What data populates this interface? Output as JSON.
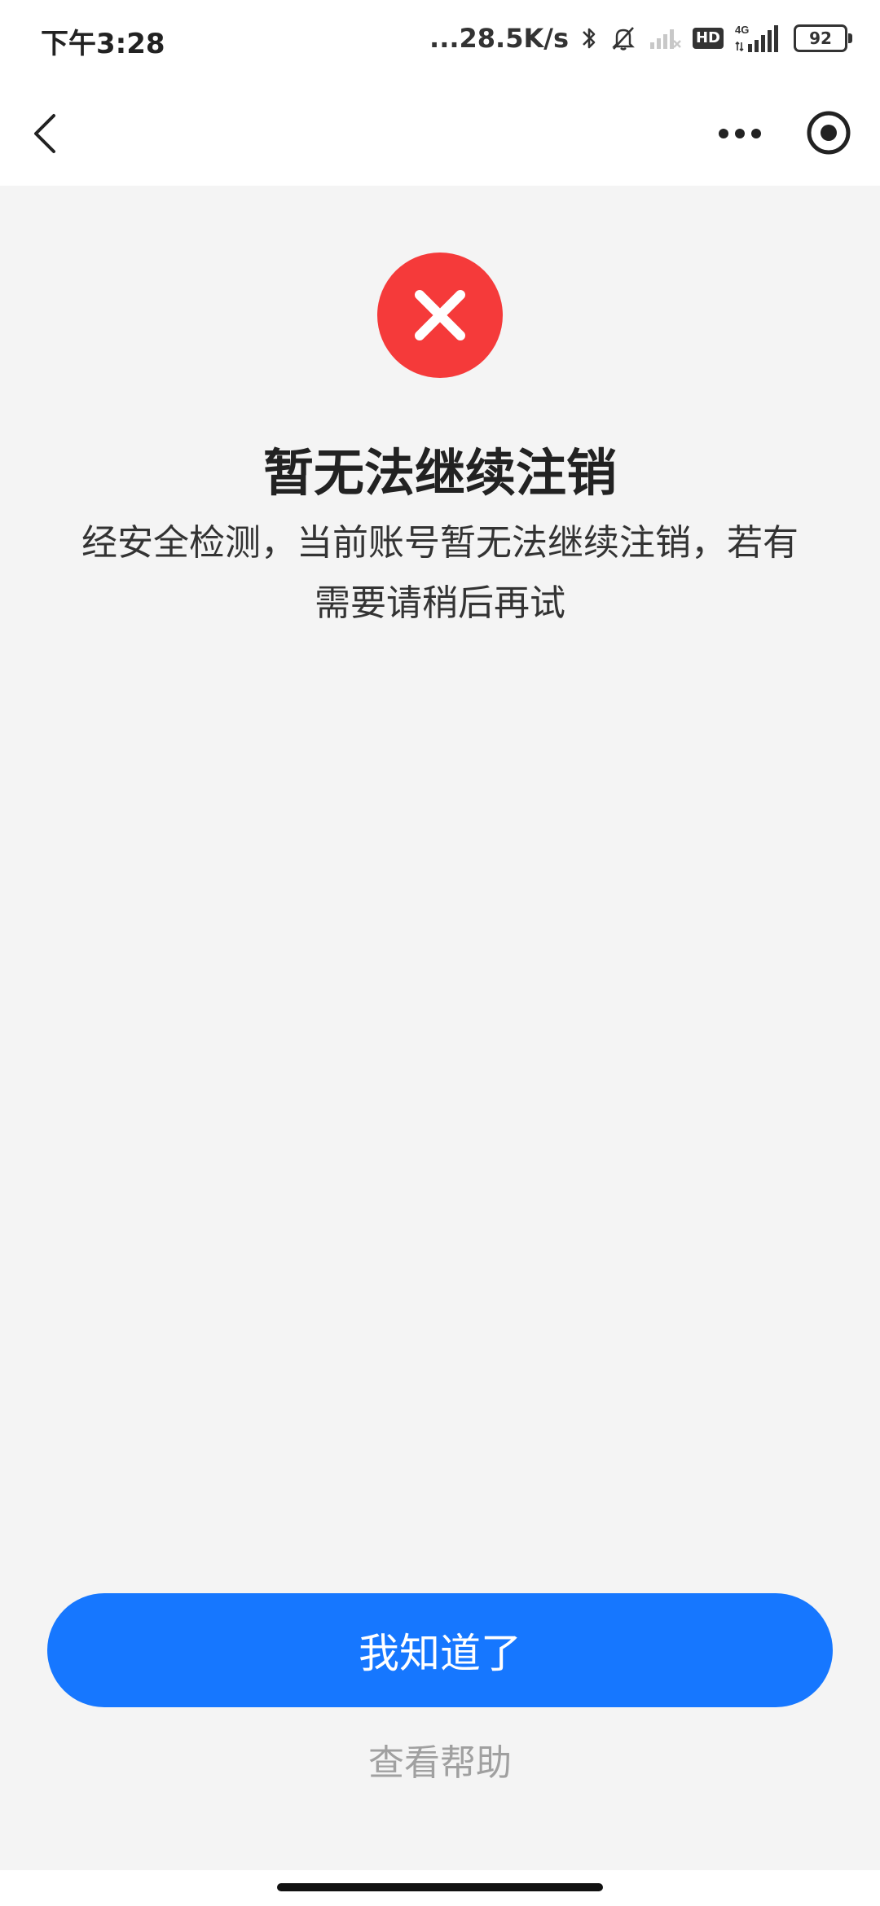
{
  "status_bar": {
    "time": "下午3:28",
    "network_speed": "...28.5K/s",
    "hd_label": "HD",
    "network_type": "4G",
    "battery": "92",
    "icons": [
      "bluetooth-icon",
      "mute-bell-icon",
      "signal-weak-icon",
      "signal-icon"
    ]
  },
  "nav_bar": {
    "icons": [
      "back-icon",
      "more-icon",
      "target-icon"
    ]
  },
  "main": {
    "status_icon": "error-circle-icon",
    "status_color": "#f53a3a",
    "title": "暂无法继续注销",
    "description": "经安全检测，当前账号暂无法继续注销，若有需要请稍后再试"
  },
  "actions": {
    "confirm_label": "我知道了",
    "confirm_color": "#1677ff",
    "help_label": "查看帮助"
  }
}
